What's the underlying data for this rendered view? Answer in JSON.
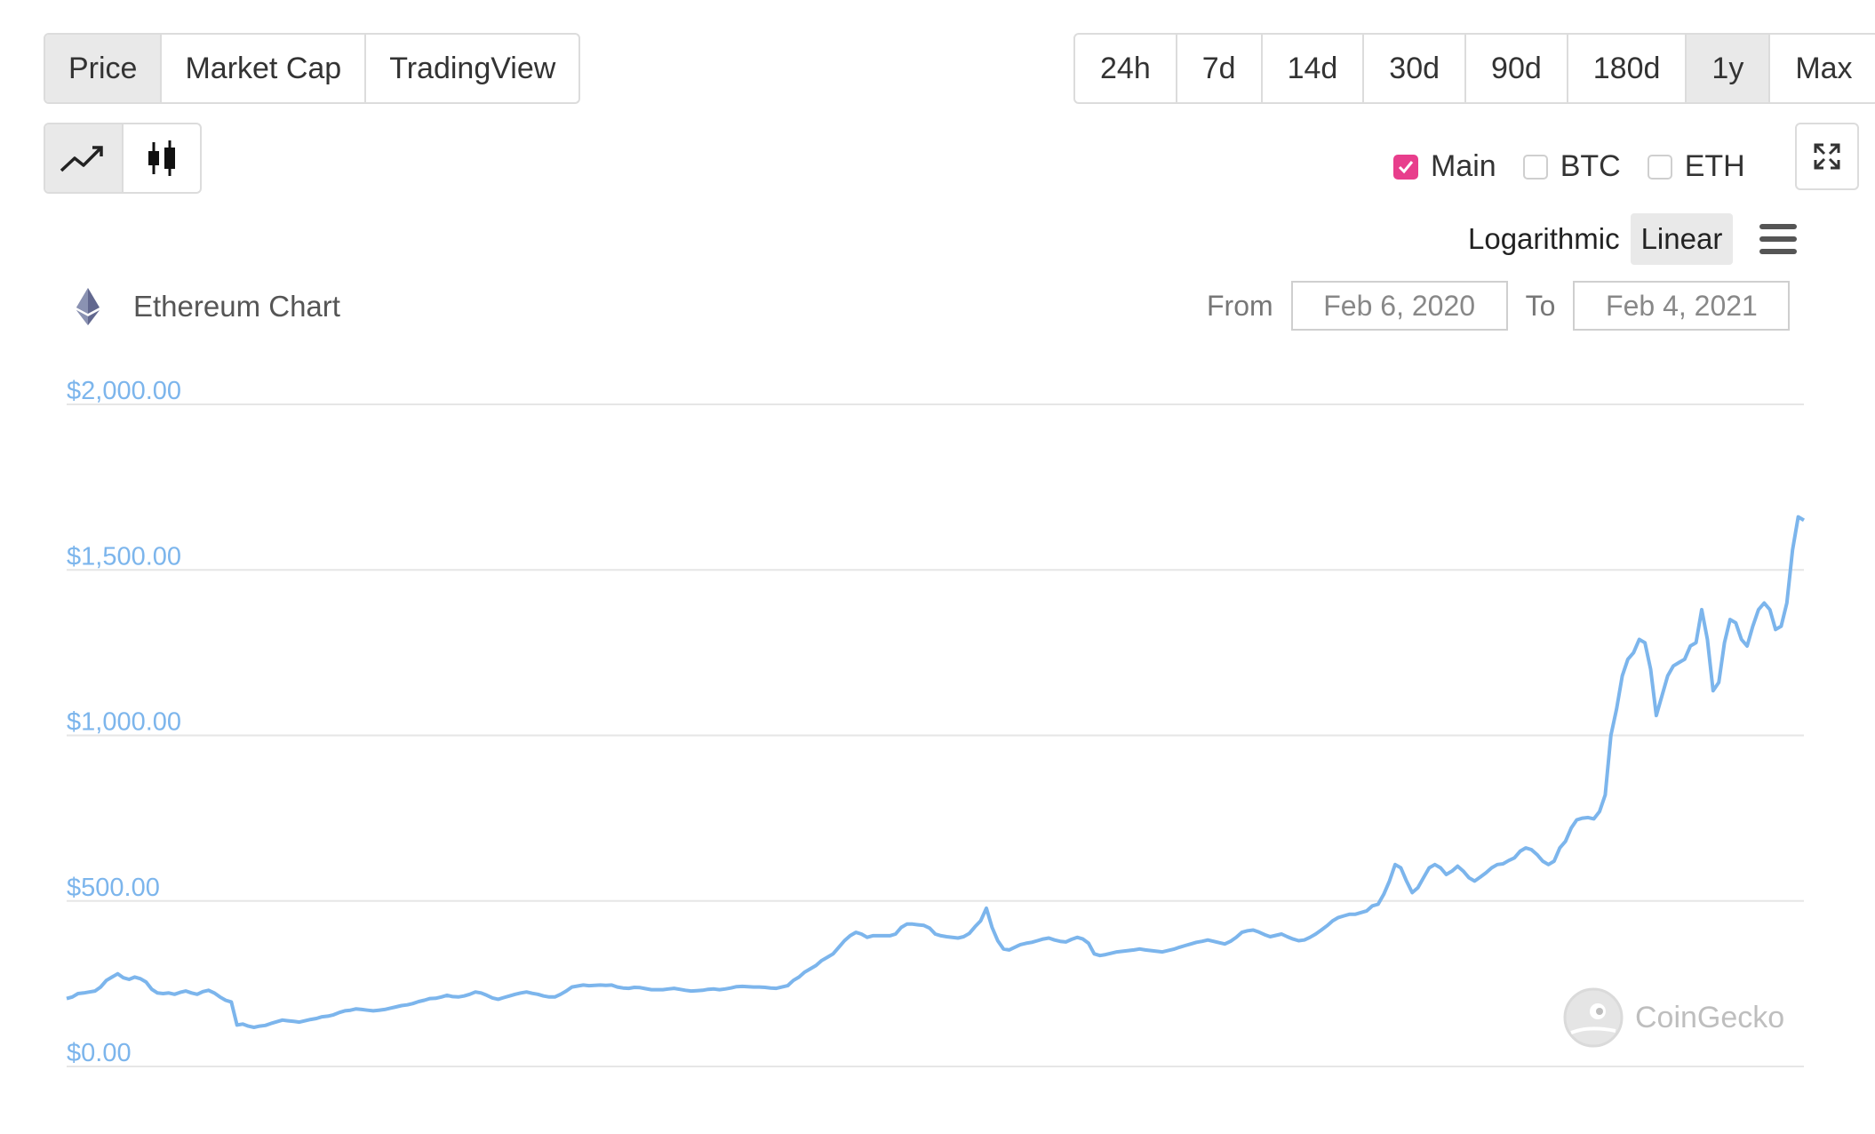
{
  "tabs": [
    {
      "label": "Price",
      "active": true
    },
    {
      "label": "Market Cap",
      "active": false
    },
    {
      "label": "TradingView",
      "active": false
    }
  ],
  "ranges": [
    {
      "label": "24h",
      "active": false
    },
    {
      "label": "7d",
      "active": false
    },
    {
      "label": "14d",
      "active": false
    },
    {
      "label": "30d",
      "active": false
    },
    {
      "label": "90d",
      "active": false
    },
    {
      "label": "180d",
      "active": false
    },
    {
      "label": "1y",
      "active": true
    },
    {
      "label": "Max",
      "active": false
    }
  ],
  "compare": [
    {
      "label": "Main",
      "checked": true
    },
    {
      "label": "BTC",
      "checked": false
    },
    {
      "label": "ETH",
      "checked": false
    }
  ],
  "scale": {
    "log_label": "Logarithmic",
    "linear_label": "Linear",
    "active": "linear"
  },
  "chart_title": "Ethereum Chart",
  "date_range": {
    "from_label": "From",
    "from_value": "Feb 6, 2020",
    "to_label": "To",
    "to_value": "Feb 4, 2021"
  },
  "watermark": "CoinGecko",
  "colors": {
    "line": "#7cb5ec",
    "accent": "#e83e8c",
    "grid": "#e6e6e6"
  },
  "chart_data": {
    "type": "line",
    "title": "Ethereum Chart",
    "x_start": "Feb 6, 2020",
    "x_end": "Feb 4, 2021",
    "ylim": [
      0,
      2000
    ],
    "yticks": [
      0,
      500,
      1000,
      1500,
      2000
    ],
    "ytick_labels": [
      "$0.00",
      "$500.00",
      "$1,000.00",
      "$1,500.00",
      "$2,000.00"
    ],
    "grid": true,
    "series": [
      {
        "values": [
          205,
          210,
          220,
          222,
          225,
          228,
          240,
          260,
          270,
          280,
          268,
          263,
          270,
          265,
          255,
          233,
          222,
          220,
          222,
          218,
          224,
          228,
          222,
          218,
          226,
          230,
          222,
          210,
          200,
          195,
          125,
          128,
          122,
          118,
          122,
          124,
          130,
          135,
          140,
          138,
          136,
          134,
          138,
          142,
          145,
          150,
          152,
          156,
          163,
          168,
          170,
          174,
          172,
          170,
          168,
          170,
          172,
          176,
          180,
          184,
          186,
          190,
          196,
          200,
          205,
          206,
          210,
          215,
          211,
          210,
          213,
          218,
          225,
          222,
          215,
          207,
          203,
          208,
          213,
          218,
          222,
          225,
          221,
          218,
          213,
          210,
          210,
          218,
          228,
          240,
          243,
          246,
          244,
          245,
          246,
          245,
          246,
          240,
          237,
          236,
          239,
          238,
          235,
          232,
          232,
          232,
          234,
          236,
          233,
          230,
          228,
          229,
          230,
          233,
          234,
          232,
          234,
          237,
          241,
          242,
          241,
          240,
          240,
          239,
          237,
          236,
          240,
          244,
          260,
          270,
          285,
          295,
          305,
          320,
          330,
          340,
          360,
          380,
          395,
          405,
          400,
          390,
          395,
          395,
          395,
          395,
          400,
          420,
          430,
          430,
          428,
          426,
          418,
          400,
          395,
          392,
          390,
          388,
          392,
          402,
          422,
          440,
          478,
          420,
          380,
          355,
          352,
          360,
          368,
          372,
          375,
          380,
          385,
          388,
          382,
          378,
          376,
          384,
          390,
          385,
          372,
          340,
          335,
          338,
          342,
          346,
          348,
          350,
          352,
          355,
          352,
          350,
          348,
          346,
          350,
          354,
          360,
          365,
          370,
          375,
          378,
          382,
          378,
          374,
          370,
          378,
          390,
          405,
          410,
          412,
          406,
          398,
          392,
          396,
          400,
          392,
          385,
          380,
          382,
          390,
          400,
          412,
          425,
          440,
          450,
          455,
          460,
          460,
          465,
          470,
          485,
          490,
          520,
          560,
          610,
          600,
          560,
          525,
          540,
          570,
          600,
          610,
          600,
          580,
          590,
          605,
          590,
          570,
          560,
          572,
          585,
          600,
          610,
          612,
          622,
          630,
          650,
          660,
          655,
          640,
          620,
          610,
          620,
          660,
          680,
          720,
          745,
          750,
          752,
          748,
          770,
          820,
          1000,
          1080,
          1180,
          1230,
          1250,
          1290,
          1280,
          1200,
          1060,
          1120,
          1180,
          1210,
          1220,
          1230,
          1270,
          1280,
          1380,
          1290,
          1135,
          1160,
          1280,
          1350,
          1340,
          1290,
          1270,
          1330,
          1380,
          1400,
          1380,
          1320,
          1330,
          1400,
          1560,
          1660,
          1650
        ]
      }
    ]
  }
}
